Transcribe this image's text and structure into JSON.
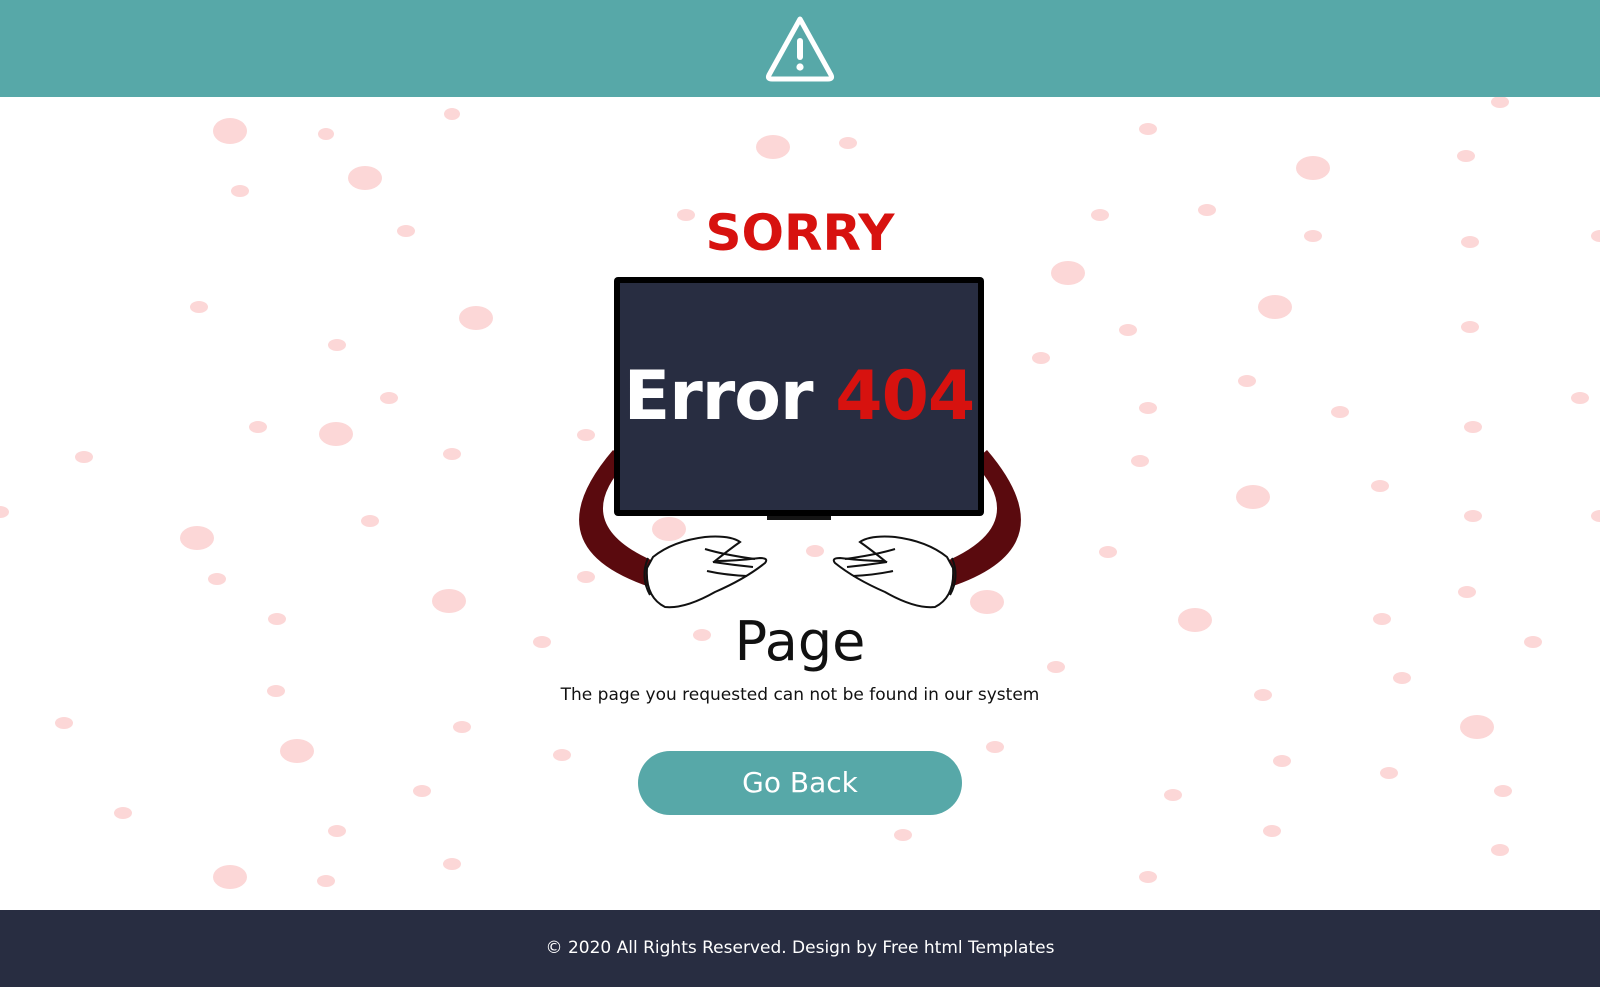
{
  "header": {
    "icon": "warning-triangle-icon",
    "background": "#57a8a8"
  },
  "content": {
    "sorry": "SORRY",
    "screen_word": "Error",
    "screen_code": "404",
    "page_word": "Page",
    "message": "The page you requested can not be found in our system",
    "button_label": "Go Back",
    "accent_red": "#d7120f",
    "screen_color": "#282d41",
    "dot_color": "#fcd7d7"
  },
  "footer": {
    "copyright": "© 2020 All Rights Reserved. Design by Free html Templates"
  }
}
